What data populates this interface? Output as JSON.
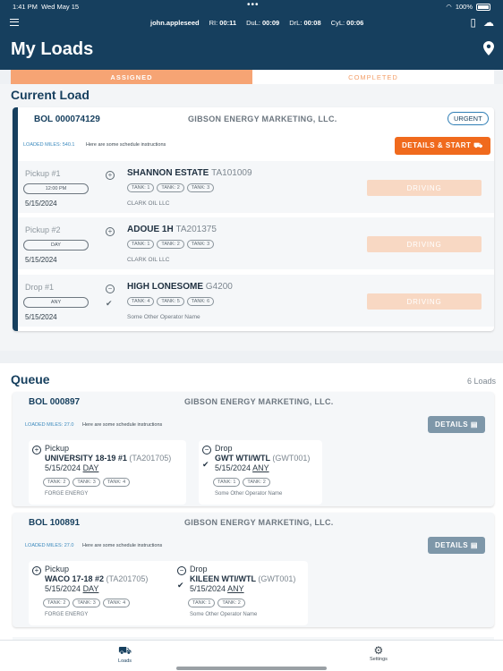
{
  "status": {
    "time": "1:41 PM",
    "date": "Wed May 15",
    "battery": "100%"
  },
  "topbar": {
    "user": "john.appleseed",
    "hos": [
      {
        "key": "RI:",
        "val": "00:11"
      },
      {
        "key": "DuL:",
        "val": "00:09"
      },
      {
        "key": "DrL:",
        "val": "00:08"
      },
      {
        "key": "CyL:",
        "val": "00:06"
      }
    ]
  },
  "page": {
    "title": "My Loads"
  },
  "tabs": {
    "assigned": "ASSIGNED",
    "completed": "COMPLETED"
  },
  "current": {
    "section_title": "Current Load",
    "bol": "BOL 000074129",
    "shipper": "GIBSON ENERGY MARKETING, LLC.",
    "urgent": "URGENT",
    "miles": "LOADED MILES: 540.1",
    "instructions": "Here are some schedule instructions",
    "details_start": "DETAILS & START",
    "stops": [
      {
        "type": "Pickup #1",
        "window": "12:00 PM",
        "date": "5/15/2024",
        "icon": "plus-circle",
        "name": "SHANNON ESTATE",
        "id": "TA101009",
        "tanks": [
          "TANK: 1",
          "TANK: 2",
          "TANK: 3"
        ],
        "operator": "CLARK OIL LLC",
        "status": "DRIVING"
      },
      {
        "type": "Pickup #2",
        "window": "DAY",
        "date": "5/15/2024",
        "icon": "plus-circle",
        "name": "ADOUE 1H",
        "id": "TA201375",
        "tanks": [
          "TANK: 1",
          "TANK: 2",
          "TANK: 3"
        ],
        "operator": "CLARK OIL LLC",
        "status": "DRIVING"
      },
      {
        "type": "Drop #1",
        "window": "ANY",
        "date": "5/15/2024",
        "icon": "minus-circle",
        "name": "HIGH LONESOME",
        "id": "G4200",
        "tanks": [
          "TANK: 4",
          "TANK: 5",
          "TANK: 6"
        ],
        "operator": "Some Other Operator Name",
        "status": "DRIVING"
      }
    ]
  },
  "queue": {
    "section_title": "Queue",
    "count": "6 Loads",
    "loads": [
      {
        "bol": "BOL 000897",
        "shipper": "GIBSON ENERGY MARKETING, LLC.",
        "miles": "LOADED MILES: 27.0",
        "instructions": "Here are some schedule instructions",
        "details": "DETAILS",
        "pickup": {
          "type": "Pickup",
          "name": "UNIVERSITY 18-19 #1",
          "id": "(TA201705)",
          "date": "5/15/2024",
          "window": "DAY",
          "tanks": [
            "TANK: 2",
            "TANK: 3",
            "TANK: 4"
          ],
          "operator": "FORGE ENERGY"
        },
        "drop": {
          "type": "Drop",
          "name": "GWT WTI/WTL",
          "id": "(GWT001)",
          "date": "5/15/2024",
          "window": "ANY",
          "tanks": [
            "TANK: 1",
            "TANK: 2"
          ],
          "operator": "Some Other Operator Name"
        }
      },
      {
        "bol": "BOL 100891",
        "shipper": "GIBSON ENERGY MARKETING, LLC.",
        "miles": "LOADED MILES: 27.0",
        "instructions": "Here are some schedule instructions",
        "details": "DETAILS",
        "pickup": {
          "type": "Pickup",
          "name": "WACO 17-18 #2",
          "id": "(TA201705)",
          "date": "5/15/2024",
          "window": "DAY",
          "tanks": [
            "TANK: 2",
            "TANK: 3",
            "TANK: 4"
          ],
          "operator": "FORGE ENERGY"
        },
        "drop": {
          "type": "Drop",
          "name": "KILEEN WTI/WTL",
          "id": "(GWT001)",
          "date": "5/15/2024",
          "window": "ANY",
          "tanks": [
            "TANK: 1",
            "TANK: 2"
          ],
          "operator": "Some Other Operator Name"
        }
      }
    ]
  },
  "tabbar": {
    "loads": "Loads",
    "settings": "Settings"
  }
}
